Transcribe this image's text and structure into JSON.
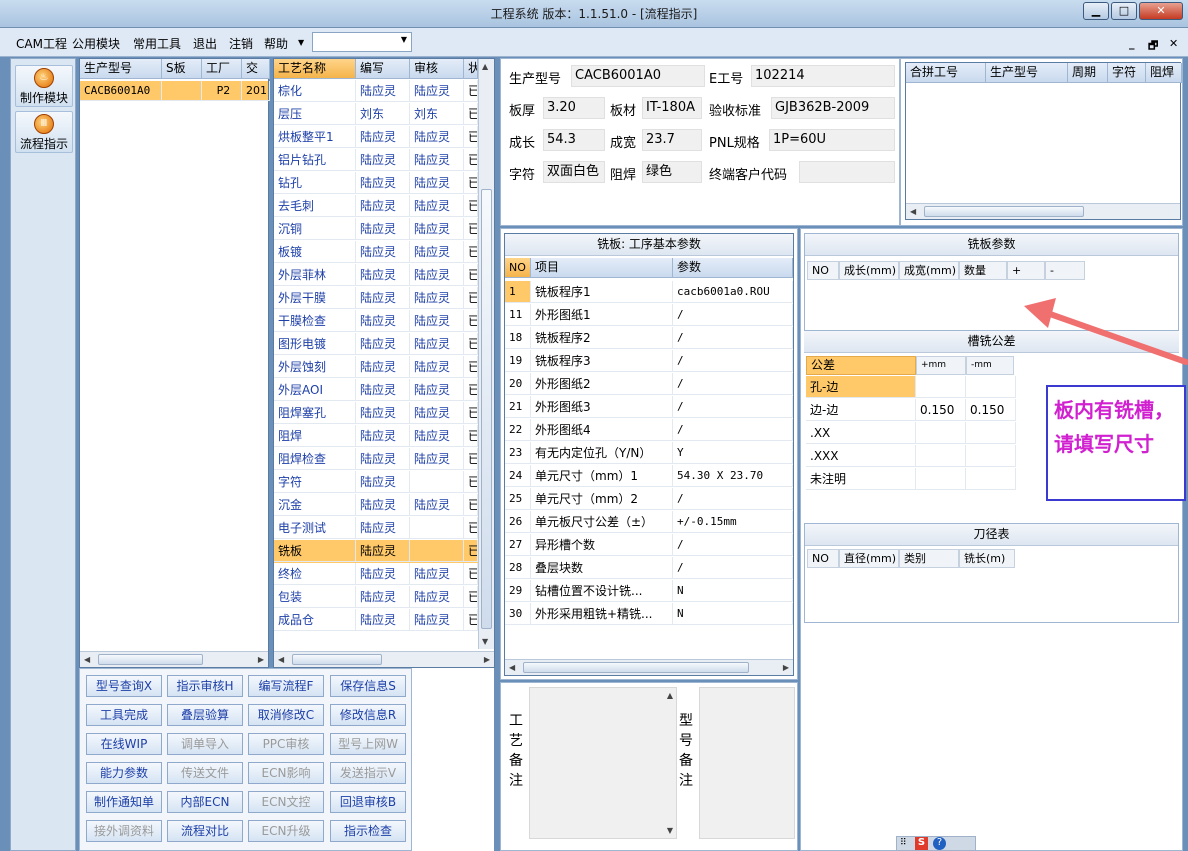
{
  "window": {
    "title": "工程系统   版本：1.1.51.0 - [流程指示]",
    "min": "▁",
    "max": "□",
    "close": "✕"
  },
  "menu": {
    "items": [
      "CAM工程",
      "公用模块",
      "常用工具",
      "退出",
      "注销",
      "帮助"
    ],
    "mdi": [
      "_",
      "🗗",
      "✕"
    ]
  },
  "leftbar": {
    "items": [
      "制作模块",
      "流程指示"
    ]
  },
  "product_table": {
    "headers": [
      "生产型号",
      "S板",
      "工厂",
      "交"
    ],
    "rows": [
      [
        "CACB6001A0",
        "",
        "P2",
        "201"
      ]
    ]
  },
  "process_table": {
    "headers": [
      "工艺名称",
      "编写",
      "审核",
      "状"
    ],
    "rows": [
      [
        "棕化",
        "陆应灵",
        "陆应灵",
        "已"
      ],
      [
        "层压",
        "刘东",
        "刘东",
        "已"
      ],
      [
        "烘板整平1",
        "陆应灵",
        "陆应灵",
        "已"
      ],
      [
        "铝片钻孔",
        "陆应灵",
        "陆应灵",
        "已"
      ],
      [
        "钻孔",
        "陆应灵",
        "陆应灵",
        "已"
      ],
      [
        "去毛刺",
        "陆应灵",
        "陆应灵",
        "已"
      ],
      [
        "沉铜",
        "陆应灵",
        "陆应灵",
        "已"
      ],
      [
        "板镀",
        "陆应灵",
        "陆应灵",
        "已"
      ],
      [
        "外层菲林",
        "陆应灵",
        "陆应灵",
        "已"
      ],
      [
        "外层干膜",
        "陆应灵",
        "陆应灵",
        "已"
      ],
      [
        "干膜检查",
        "陆应灵",
        "陆应灵",
        "已"
      ],
      [
        "图形电镀",
        "陆应灵",
        "陆应灵",
        "已"
      ],
      [
        "外层蚀刻",
        "陆应灵",
        "陆应灵",
        "已"
      ],
      [
        "外层AOI",
        "陆应灵",
        "陆应灵",
        "已"
      ],
      [
        "阻焊塞孔",
        "陆应灵",
        "陆应灵",
        "已"
      ],
      [
        "阻焊",
        "陆应灵",
        "陆应灵",
        "已"
      ],
      [
        "阻焊检查",
        "陆应灵",
        "陆应灵",
        "已"
      ],
      [
        "字符",
        "陆应灵",
        "",
        "已"
      ],
      [
        "沉金",
        "陆应灵",
        "陆应灵",
        "已"
      ],
      [
        "电子测试",
        "陆应灵",
        "",
        "已"
      ],
      [
        "铣板",
        "陆应灵",
        "",
        "已"
      ],
      [
        "终检",
        "陆应灵",
        "陆应灵",
        "已"
      ],
      [
        "包装",
        "陆应灵",
        "陆应灵",
        "已"
      ],
      [
        "成品仓",
        "陆应灵",
        "陆应灵",
        "已"
      ]
    ],
    "selected_index": 20
  },
  "buttons": [
    [
      "型号查询X",
      "指示审核H",
      "编写流程F",
      "保存信息S"
    ],
    [
      "工具完成",
      "叠层验算",
      "取消修改C",
      "修改信息R"
    ],
    [
      "在线WIP",
      "调单导入",
      "PPC审核",
      "型号上网W"
    ],
    [
      "能力参数",
      "传送文件",
      "ECN影响",
      "发送指示V"
    ],
    [
      "制作通知单",
      "内部ECN",
      "ECN文控",
      "回退审核B"
    ],
    [
      "接外调资料",
      "流程对比",
      "ECN升级",
      "指示检查"
    ]
  ],
  "buttons_disabled": [
    [
      false,
      false,
      false,
      false
    ],
    [
      false,
      false,
      false,
      false
    ],
    [
      false,
      true,
      true,
      true
    ],
    [
      false,
      true,
      true,
      true
    ],
    [
      false,
      false,
      true,
      false
    ],
    [
      true,
      false,
      true,
      false
    ]
  ],
  "info": {
    "labels": [
      "生产型号",
      "E工号",
      "板厚",
      "板材",
      "验收标准",
      "成长",
      "成宽",
      "PNL规格",
      "字符",
      "阻焊",
      "终端客户代码"
    ],
    "values": [
      "CACB6001A0",
      "102214",
      "3.20",
      "IT-180A",
      "GJB362B-2009",
      "54.3",
      "23.7",
      "1P=60U",
      "双面白色",
      "绿色",
      ""
    ]
  },
  "merge_table": {
    "headers": [
      "合拼工号",
      "生产型号",
      "周期",
      "字符",
      "阻焊"
    ]
  },
  "mill_params": {
    "title": "铣板: 工序基本参数",
    "headers": [
      "NO",
      "项目",
      "参数"
    ],
    "rows": [
      [
        "1",
        "铣板程序1",
        "cacb6001a0.ROU"
      ],
      [
        "11",
        "外形图纸1",
        "/"
      ],
      [
        "18",
        "铣板程序2",
        "/"
      ],
      [
        "19",
        "铣板程序3",
        "/"
      ],
      [
        "20",
        "外形图纸2",
        "/"
      ],
      [
        "21",
        "外形图纸3",
        "/"
      ],
      [
        "22",
        "外形图纸4",
        "/"
      ],
      [
        "23",
        "有无内定位孔（Y/N）",
        "Y"
      ],
      [
        "24",
        "单元尺寸（mm）1",
        "54.30 X 23.70"
      ],
      [
        "25",
        "单元尺寸（mm）2",
        "/"
      ],
      [
        "26",
        "单元板尺寸公差（±）",
        "+/-0.15mm"
      ],
      [
        "27",
        "异形槽个数",
        "/"
      ],
      [
        "28",
        "叠层块数",
        "/"
      ],
      [
        "29",
        "钻槽位置不设计铣...",
        "N"
      ],
      [
        "30",
        "外形采用粗铣+精铣...",
        "N"
      ]
    ]
  },
  "mill_board": {
    "title": "铣板参数",
    "headers": [
      "NO",
      "成长(mm)",
      "成宽(mm)",
      "数量",
      "+",
      "-"
    ]
  },
  "slot_tol": {
    "title": "槽铣公差",
    "headers": [
      "公差",
      "+mm",
      "-mm"
    ],
    "rows": [
      [
        "孔-边",
        "",
        ""
      ],
      [
        "边-边",
        "0.150",
        "0.150"
      ],
      [
        ".XX",
        "",
        ""
      ],
      [
        ".XXX",
        "",
        ""
      ],
      [
        "未注明",
        "",
        ""
      ]
    ]
  },
  "tool_table": {
    "title": "刀径表",
    "headers": [
      "NO",
      "直径(mm)",
      "类别",
      "铣长(m)"
    ]
  },
  "remarks": {
    "craft": "工艺备注",
    "model": "型号备注"
  },
  "callout": "板内有铣槽，请填写尺寸",
  "tray": {
    "s": "S",
    "q": "?"
  }
}
